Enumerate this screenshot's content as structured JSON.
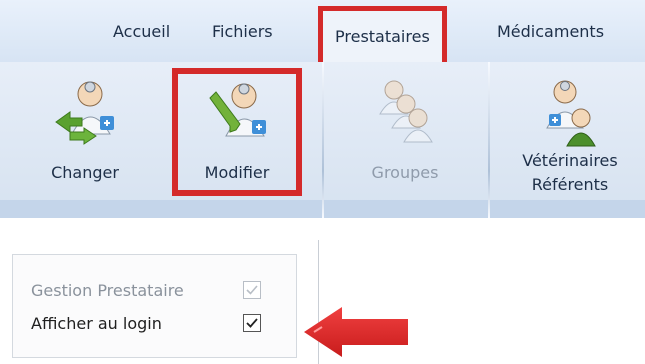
{
  "tabs": [
    {
      "label": "Accueil"
    },
    {
      "label": "Fichiers"
    },
    {
      "label": "Prestataires",
      "active": true
    },
    {
      "label": "Médicaments"
    }
  ],
  "ribbon": {
    "buttons": [
      {
        "label": "Changer",
        "icon": "change-provider-icon",
        "enabled": true
      },
      {
        "label": "Modifier",
        "icon": "edit-provider-icon",
        "enabled": true,
        "highlighted": true
      },
      {
        "label": "Groupes",
        "icon": "groups-icon",
        "enabled": false
      },
      {
        "label_line1": "Vétérinaires",
        "label_line2": "Référents",
        "icon": "referring-vets-icon",
        "enabled": true
      }
    ]
  },
  "options": {
    "items": [
      {
        "label": "Gestion Prestataire",
        "checked": true,
        "enabled": false
      },
      {
        "label": "Afficher au login",
        "checked": true,
        "enabled": true
      }
    ]
  },
  "colors": {
    "highlight": "#d42a2a",
    "ribbon_bg": "#dde7f3",
    "text": "#1d2f48"
  }
}
